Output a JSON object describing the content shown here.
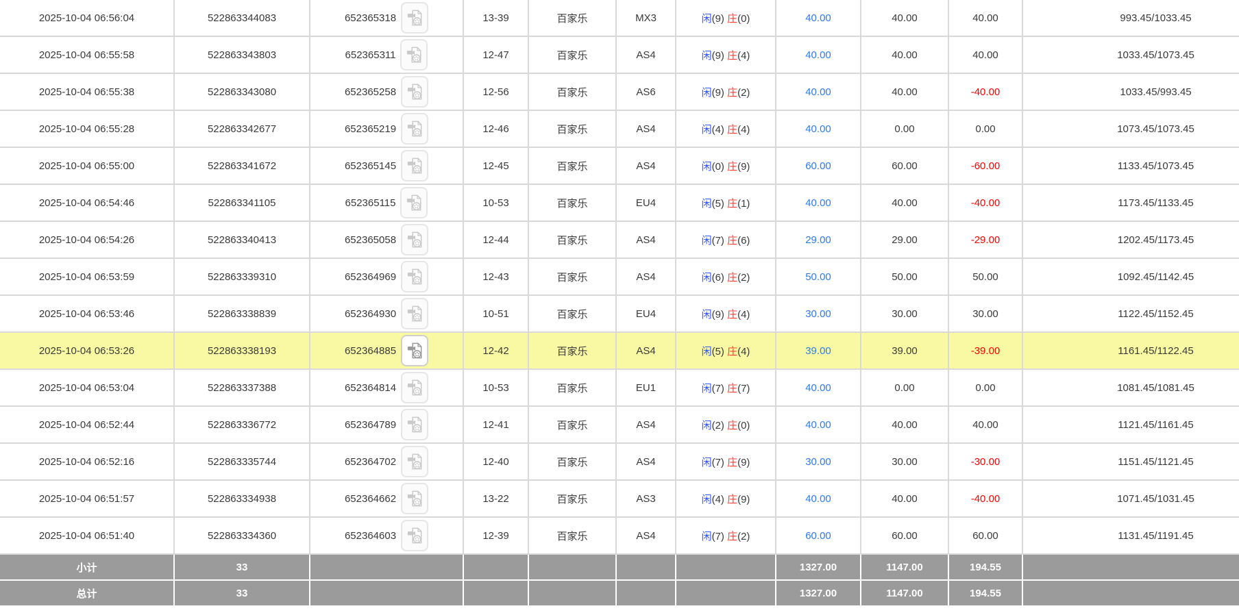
{
  "labels": {
    "player": "闲",
    "banker": "庄",
    "game_default": "百家乐"
  },
  "colors": {
    "bet_link_blue": "#2c7bee",
    "player_blue": "#3355ff",
    "banker_red": "#ff3b2f",
    "negative_red": "#fb0000",
    "highlight_yellow": "#f9f9a3",
    "summary_grey": "#9b9b9b",
    "border_grey": "#d9d9d9"
  },
  "icons": {
    "video_replay": "video-file-icon"
  },
  "rows": [
    {
      "time": "2025-10-04 06:56:04",
      "order_no": "522863344083",
      "round_no": "652365318",
      "shoe_round": "13-39",
      "game": "百家乐",
      "table_code": "MX3",
      "player_score": "9",
      "banker_score": "0",
      "bet": "40.00",
      "valid_bet": "40.00",
      "win_loss": "40.00",
      "balance": "993.45/1033.45",
      "highlight": false
    },
    {
      "time": "2025-10-04 06:55:58",
      "order_no": "522863343803",
      "round_no": "652365311",
      "shoe_round": "12-47",
      "game": "百家乐",
      "table_code": "AS4",
      "player_score": "9",
      "banker_score": "4",
      "bet": "40.00",
      "valid_bet": "40.00",
      "win_loss": "40.00",
      "balance": "1033.45/1073.45",
      "highlight": false
    },
    {
      "time": "2025-10-04 06:55:38",
      "order_no": "522863343080",
      "round_no": "652365258",
      "shoe_round": "12-56",
      "game": "百家乐",
      "table_code": "AS6",
      "player_score": "9",
      "banker_score": "2",
      "bet": "40.00",
      "valid_bet": "40.00",
      "win_loss": "-40.00",
      "balance": "1033.45/993.45",
      "highlight": false
    },
    {
      "time": "2025-10-04 06:55:28",
      "order_no": "522863342677",
      "round_no": "652365219",
      "shoe_round": "12-46",
      "game": "百家乐",
      "table_code": "AS4",
      "player_score": "4",
      "banker_score": "4",
      "bet": "40.00",
      "valid_bet": "0.00",
      "win_loss": "0.00",
      "balance": "1073.45/1073.45",
      "highlight": false
    },
    {
      "time": "2025-10-04 06:55:00",
      "order_no": "522863341672",
      "round_no": "652365145",
      "shoe_round": "12-45",
      "game": "百家乐",
      "table_code": "AS4",
      "player_score": "0",
      "banker_score": "9",
      "bet": "60.00",
      "valid_bet": "60.00",
      "win_loss": "-60.00",
      "balance": "1133.45/1073.45",
      "highlight": false
    },
    {
      "time": "2025-10-04 06:54:46",
      "order_no": "522863341105",
      "round_no": "652365115",
      "shoe_round": "10-53",
      "game": "百家乐",
      "table_code": "EU4",
      "player_score": "5",
      "banker_score": "1",
      "bet": "40.00",
      "valid_bet": "40.00",
      "win_loss": "-40.00",
      "balance": "1173.45/1133.45",
      "highlight": false
    },
    {
      "time": "2025-10-04 06:54:26",
      "order_no": "522863340413",
      "round_no": "652365058",
      "shoe_round": "12-44",
      "game": "百家乐",
      "table_code": "AS4",
      "player_score": "7",
      "banker_score": "6",
      "bet": "29.00",
      "valid_bet": "29.00",
      "win_loss": "-29.00",
      "balance": "1202.45/1173.45",
      "highlight": false
    },
    {
      "time": "2025-10-04 06:53:59",
      "order_no": "522863339310",
      "round_no": "652364969",
      "shoe_round": "12-43",
      "game": "百家乐",
      "table_code": "AS4",
      "player_score": "6",
      "banker_score": "2",
      "bet": "50.00",
      "valid_bet": "50.00",
      "win_loss": "50.00",
      "balance": "1092.45/1142.45",
      "highlight": false
    },
    {
      "time": "2025-10-04 06:53:46",
      "order_no": "522863338839",
      "round_no": "652364930",
      "shoe_round": "10-51",
      "game": "百家乐",
      "table_code": "EU4",
      "player_score": "9",
      "banker_score": "4",
      "bet": "30.00",
      "valid_bet": "30.00",
      "win_loss": "30.00",
      "balance": "1122.45/1152.45",
      "highlight": false
    },
    {
      "time": "2025-10-04 06:53:26",
      "order_no": "522863338193",
      "round_no": "652364885",
      "shoe_round": "12-42",
      "game": "百家乐",
      "table_code": "AS4",
      "player_score": "5",
      "banker_score": "4",
      "bet": "39.00",
      "valid_bet": "39.00",
      "win_loss": "-39.00",
      "balance": "1161.45/1122.45",
      "highlight": true
    },
    {
      "time": "2025-10-04 06:53:04",
      "order_no": "522863337388",
      "round_no": "652364814",
      "shoe_round": "10-53",
      "game": "百家乐",
      "table_code": "EU1",
      "player_score": "7",
      "banker_score": "7",
      "bet": "40.00",
      "valid_bet": "0.00",
      "win_loss": "0.00",
      "balance": "1081.45/1081.45",
      "highlight": false
    },
    {
      "time": "2025-10-04 06:52:44",
      "order_no": "522863336772",
      "round_no": "652364789",
      "shoe_round": "12-41",
      "game": "百家乐",
      "table_code": "AS4",
      "player_score": "2",
      "banker_score": "0",
      "bet": "40.00",
      "valid_bet": "40.00",
      "win_loss": "40.00",
      "balance": "1121.45/1161.45",
      "highlight": false
    },
    {
      "time": "2025-10-04 06:52:16",
      "order_no": "522863335744",
      "round_no": "652364702",
      "shoe_round": "12-40",
      "game": "百家乐",
      "table_code": "AS4",
      "player_score": "7",
      "banker_score": "9",
      "bet": "30.00",
      "valid_bet": "30.00",
      "win_loss": "-30.00",
      "balance": "1151.45/1121.45",
      "highlight": false
    },
    {
      "time": "2025-10-04 06:51:57",
      "order_no": "522863334938",
      "round_no": "652364662",
      "shoe_round": "13-22",
      "game": "百家乐",
      "table_code": "AS3",
      "player_score": "4",
      "banker_score": "9",
      "bet": "40.00",
      "valid_bet": "40.00",
      "win_loss": "-40.00",
      "balance": "1071.45/1031.45",
      "highlight": false
    },
    {
      "time": "2025-10-04 06:51:40",
      "order_no": "522863334360",
      "round_no": "652364603",
      "shoe_round": "12-39",
      "game": "百家乐",
      "table_code": "AS4",
      "player_score": "7",
      "banker_score": "2",
      "bet": "60.00",
      "valid_bet": "60.00",
      "win_loss": "60.00",
      "balance": "1131.45/1191.45",
      "highlight": false
    }
  ],
  "summary": [
    {
      "key": "subtotal",
      "label": "小计",
      "count": "33",
      "bet": "1327.00",
      "valid_bet": "1147.00",
      "win_loss": "194.55"
    },
    {
      "key": "total",
      "label": "总计",
      "count": "33",
      "bet": "1327.00",
      "valid_bet": "1147.00",
      "win_loss": "194.55"
    }
  ]
}
